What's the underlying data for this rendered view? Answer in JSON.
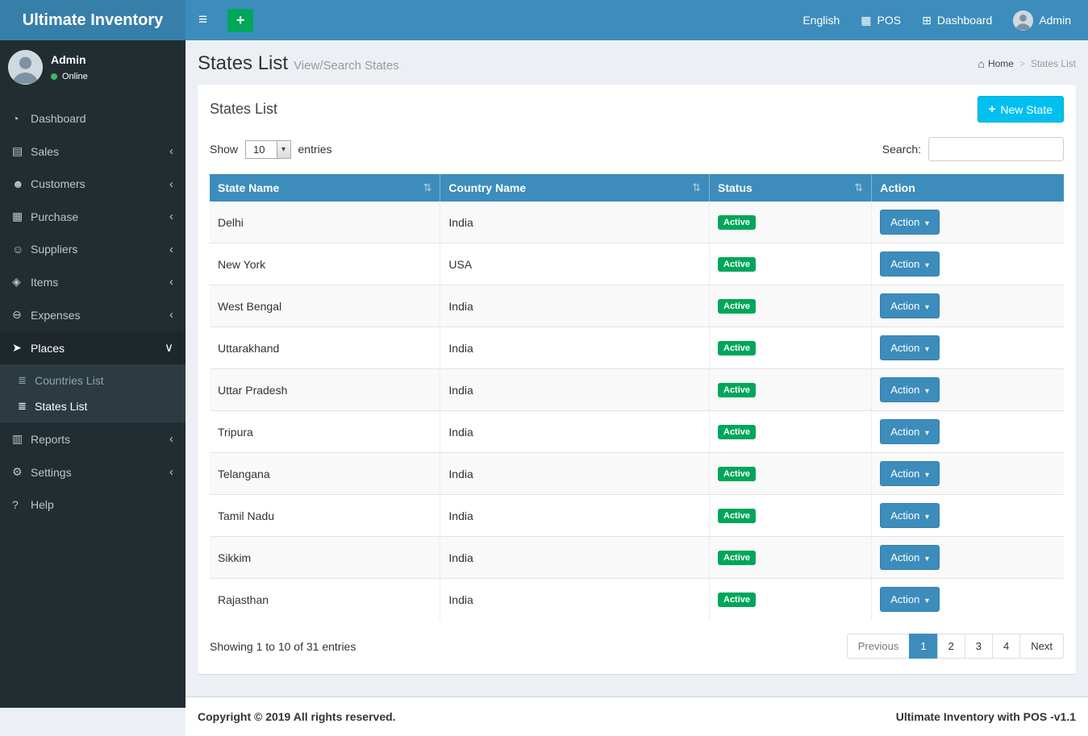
{
  "navbar": {
    "brand": "Ultimate Inventory",
    "links": {
      "language": "English",
      "pos": "POS",
      "dashboard": "Dashboard",
      "user": "Admin"
    }
  },
  "sidebar": {
    "user": {
      "name": "Admin",
      "status": "Online"
    },
    "menu": [
      {
        "label": "Dashboard",
        "icon": "dashboard-icon"
      },
      {
        "label": "Sales",
        "icon": "sales-icon",
        "expandable": true
      },
      {
        "label": "Customers",
        "icon": "customers-icon",
        "expandable": true
      },
      {
        "label": "Purchase",
        "icon": "purchase-icon",
        "expandable": true
      },
      {
        "label": "Suppliers",
        "icon": "suppliers-icon",
        "expandable": true
      },
      {
        "label": "Items",
        "icon": "items-icon",
        "expandable": true
      },
      {
        "label": "Expenses",
        "icon": "expenses-icon",
        "expandable": true
      },
      {
        "label": "Places",
        "icon": "places-icon",
        "expandable": true,
        "active": true,
        "open": true,
        "children": [
          {
            "label": "Countries List",
            "icon": "list-icon"
          },
          {
            "label": "States List",
            "icon": "list-icon",
            "active": true
          }
        ]
      },
      {
        "label": "Reports",
        "icon": "reports-icon",
        "expandable": true
      },
      {
        "label": "Settings",
        "icon": "settings-icon",
        "expandable": true
      },
      {
        "label": "Help",
        "icon": "help-icon"
      }
    ]
  },
  "page": {
    "title": "States List",
    "subtitle": "View/Search States",
    "breadcrumb": {
      "home": "Home",
      "separator": ">",
      "current": "States List"
    }
  },
  "box": {
    "title": "States List",
    "new_state_button": "New State"
  },
  "controls": {
    "show_label": "Show",
    "page_size": "10",
    "entries_label": "entries",
    "search_label": "Search:",
    "search_value": ""
  },
  "table": {
    "columns": [
      {
        "label": "State Name",
        "sortable": true
      },
      {
        "label": "Country Name",
        "sortable": true
      },
      {
        "label": "Status",
        "sortable": true
      },
      {
        "label": "Action",
        "sortable": false
      }
    ],
    "rows": [
      {
        "state_name": "Delhi",
        "country_name": "India",
        "status": "Active",
        "action_label": "Action"
      },
      {
        "state_name": "New York",
        "country_name": "USA",
        "status": "Active",
        "action_label": "Action"
      },
      {
        "state_name": "West Bengal",
        "country_name": "India",
        "status": "Active",
        "action_label": "Action"
      },
      {
        "state_name": "Uttarakhand",
        "country_name": "India",
        "status": "Active",
        "action_label": "Action"
      },
      {
        "state_name": "Uttar Pradesh",
        "country_name": "India",
        "status": "Active",
        "action_label": "Action"
      },
      {
        "state_name": "Tripura",
        "country_name": "India",
        "status": "Active",
        "action_label": "Action"
      },
      {
        "state_name": "Telangana",
        "country_name": "India",
        "status": "Active",
        "action_label": "Action"
      },
      {
        "state_name": "Tamil Nadu",
        "country_name": "India",
        "status": "Active",
        "action_label": "Action"
      },
      {
        "state_name": "Sikkim",
        "country_name": "India",
        "status": "Active",
        "action_label": "Action"
      },
      {
        "state_name": "Rajasthan",
        "country_name": "India",
        "status": "Active",
        "action_label": "Action"
      }
    ]
  },
  "table_footer": {
    "info": "Showing 1 to 10 of 31 entries",
    "pagination": {
      "previous": "Previous",
      "pages": [
        "1",
        "2",
        "3",
        "4"
      ],
      "active": "1",
      "next": "Next"
    }
  },
  "footer": {
    "copyright": "Copyright © 2019 All rights reserved.",
    "brand": "Ultimate Inventory with POS -v1.1"
  },
  "colors": {
    "navbar": "#3c8dbc",
    "logo": "#367fa9",
    "sidebar": "#222d32",
    "sidebar_submenu": "#2c3b41",
    "accent_green": "#00a65a",
    "new_button_blue": "#00c0ef",
    "table_header_blue": "#3c8dbc",
    "badge_active_green": "#00a65a"
  }
}
